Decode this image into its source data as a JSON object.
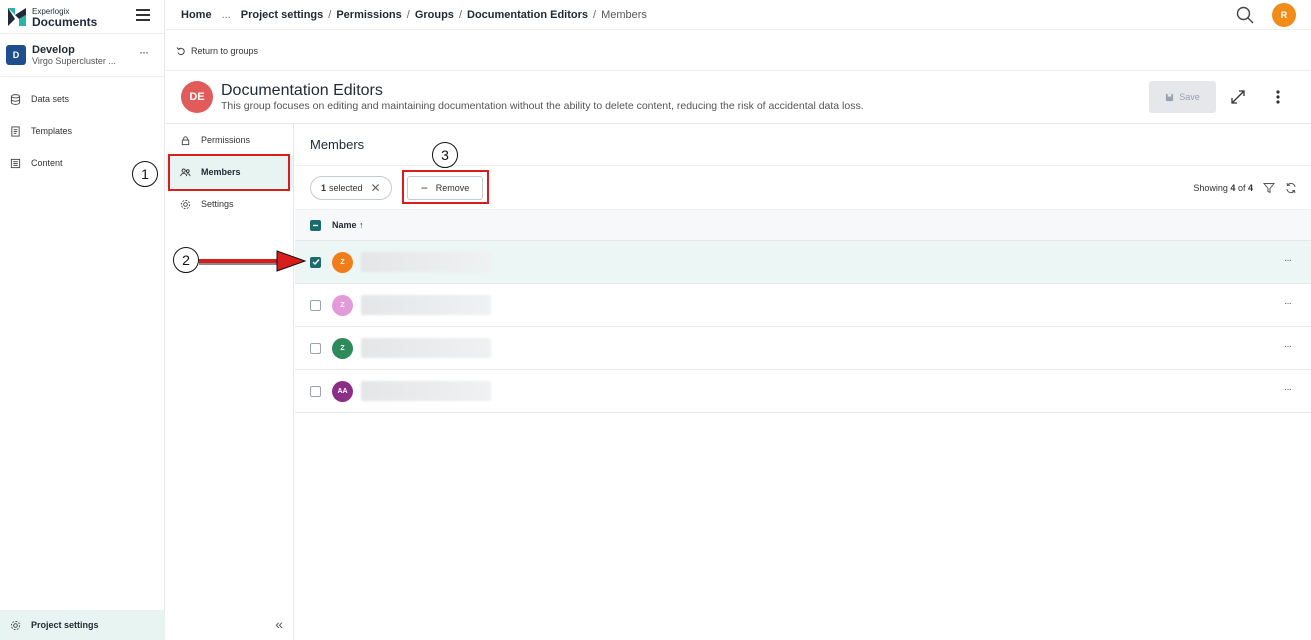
{
  "app": {
    "logo_small": "Experlogix",
    "logo_big": "Documents"
  },
  "project": {
    "badge": "D",
    "name": "Develop",
    "subtitle": "Virgo Supercluster ..."
  },
  "sidebar": {
    "items": [
      {
        "label": "Data sets",
        "icon": "database-icon"
      },
      {
        "label": "Templates",
        "icon": "document-icon"
      },
      {
        "label": "Content",
        "icon": "content-icon"
      }
    ],
    "bottom_label": "Project settings"
  },
  "breadcrumb": {
    "items": [
      "Home",
      "...",
      "Project settings",
      "Permissions",
      "Groups",
      "Documentation Editors",
      "Members"
    ]
  },
  "user": {
    "initial": "R"
  },
  "return_label": "Return to groups",
  "group": {
    "initials": "DE",
    "title": "Documentation Editors",
    "description": "This group focuses on editing and maintaining documentation without the ability to delete content, reducing the risk of accidental data loss.",
    "save_label": "Save"
  },
  "subnav": {
    "items": [
      {
        "label": "Permissions",
        "icon": "lock-icon"
      },
      {
        "label": "Members",
        "icon": "users-icon"
      },
      {
        "label": "Settings",
        "icon": "gear-icon"
      }
    ]
  },
  "members": {
    "title": "Members",
    "selected_count": "1",
    "selected_suffix": "selected",
    "remove_label": "Remove",
    "showing_prefix": "Showing",
    "showing_count": "4",
    "showing_of": "of",
    "showing_total": "4",
    "column_name": "Name ↑",
    "rows": [
      {
        "initials": "Z",
        "color": "#f07c1a",
        "selected": true
      },
      {
        "initials": "Z",
        "color": "#e39ad8",
        "selected": false
      },
      {
        "initials": "Z",
        "color": "#2e8a5a",
        "selected": false
      },
      {
        "initials": "AA",
        "color": "#8a2e86",
        "selected": false
      }
    ]
  },
  "annotations": {
    "one": "1",
    "two": "2",
    "three": "3"
  },
  "colors": {
    "accent": "#1a6b6b",
    "annotation_red": "#d91c1c",
    "brand_navy": "#1f4e8c"
  }
}
